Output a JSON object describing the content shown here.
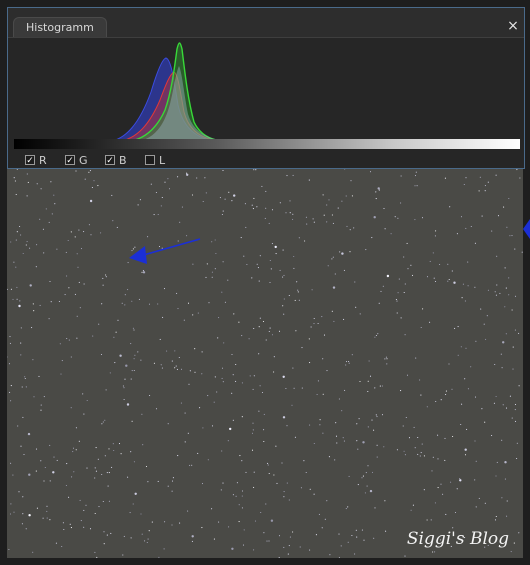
{
  "histogram_panel": {
    "tab_label": "Histogramm",
    "close_glyph": "×",
    "channels": [
      {
        "label": "R",
        "checked": true,
        "color": "#d03030"
      },
      {
        "label": "G",
        "checked": true,
        "color": "#30c030"
      },
      {
        "label": "B",
        "checked": true,
        "color": "#3040d0"
      },
      {
        "label": "L",
        "checked": false,
        "color": "#c0c0c0"
      }
    ]
  },
  "annotation": {
    "arrow_color": "#1b2fd6"
  },
  "watermark": "Siggi's Blog",
  "icons": [
    "close-icon",
    "checkbox-icon",
    "arrow-annotation-icon",
    "side-marker-icon"
  ]
}
